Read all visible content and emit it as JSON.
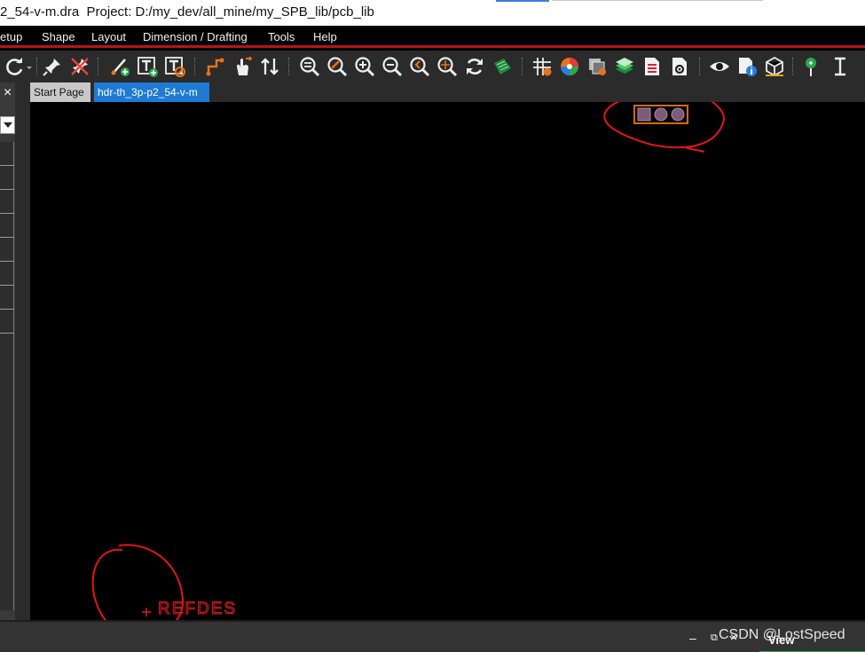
{
  "window": {
    "title": "2_54-v-m.dra  Project: D:/my_dev/all_mine/my_SPB_lib/pcb_lib"
  },
  "menu": {
    "items": [
      "etup",
      "Shape",
      "Layout",
      "Dimension / Drafting",
      "Tools",
      "Help"
    ]
  },
  "toolbar": {
    "icons": [
      "redo-icon",
      "pin-icon",
      "unpin-icon",
      "add-line-icon",
      "add-text-icon",
      "edit-text-icon",
      "connect-icon",
      "move-icon",
      "swap-icon",
      "zoom-fit-icon",
      "zoom-pan-icon",
      "zoom-in-icon",
      "zoom-out-icon",
      "zoom-previous-icon",
      "zoom-center-icon",
      "redraw-icon",
      "3d-board-icon",
      "grid-icon",
      "color-icon",
      "shadow-icon",
      "layers-icon",
      "report-icon",
      "settings-icon",
      "visibility-icon",
      "info-icon",
      "model-icon",
      "marker-icon",
      "measure-icon"
    ]
  },
  "left_panel": {
    "close_label": "×",
    "rows": 8
  },
  "tabs": [
    {
      "label": "Start Page",
      "active": false
    },
    {
      "label": "hdr-th_3p-p2_54-v-m",
      "active": true
    }
  ],
  "canvas": {
    "footprint_pads": [
      "square-pad",
      "round-pad",
      "round-pad"
    ],
    "refdes_label": "REFDES",
    "colors": {
      "annotation": "#e01818",
      "outline": "#d46a10",
      "pad": "#7b5a7a",
      "text": "#d41c1c"
    }
  },
  "bottom_bar": {
    "minimize": "–",
    "restore": "⧉",
    "close": "×",
    "view_label": "View"
  },
  "watermark": "CSDN @LostSpeed"
}
